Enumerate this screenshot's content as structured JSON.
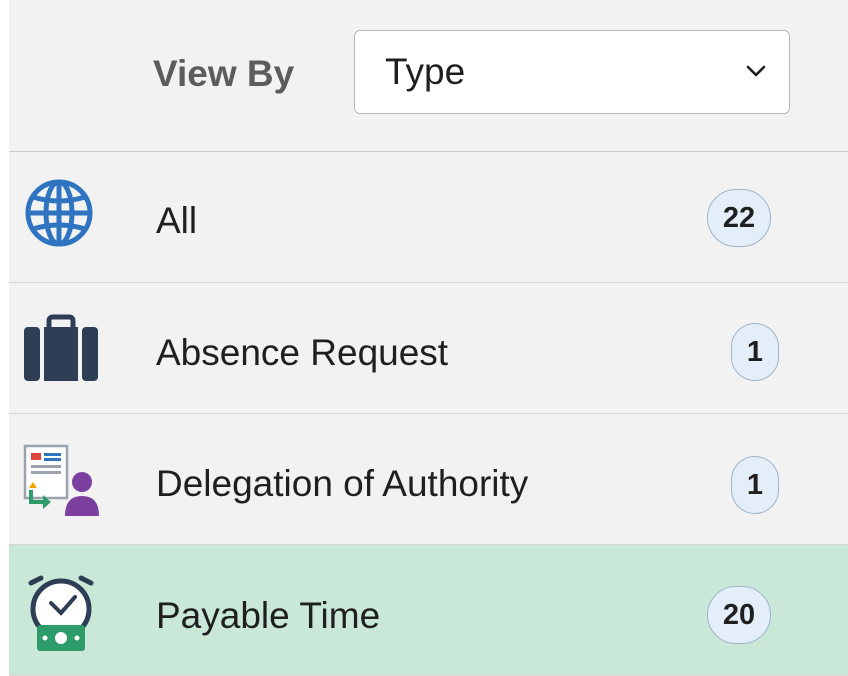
{
  "header": {
    "view_by_label": "View By",
    "select_value": "Type"
  },
  "rows": [
    {
      "label": "All",
      "count": "22",
      "icon": "globe-icon",
      "selected": false
    },
    {
      "label": "Absence Request",
      "count": "1",
      "icon": "briefcase-icon",
      "selected": false
    },
    {
      "label": "Delegation of Authority",
      "count": "1",
      "icon": "delegation-icon",
      "selected": false
    },
    {
      "label": "Payable Time",
      "count": "20",
      "icon": "clock-money-icon",
      "selected": true
    }
  ],
  "colors": {
    "selected_row": "#c9e8d8",
    "row_background": "#f2f2f2",
    "badge_background": "#e4eef8",
    "globe_blue": "#2f74c0",
    "briefcase_navy": "#2e3f55",
    "person_purple": "#7b3fa0",
    "money_green": "#2d9b6a"
  }
}
